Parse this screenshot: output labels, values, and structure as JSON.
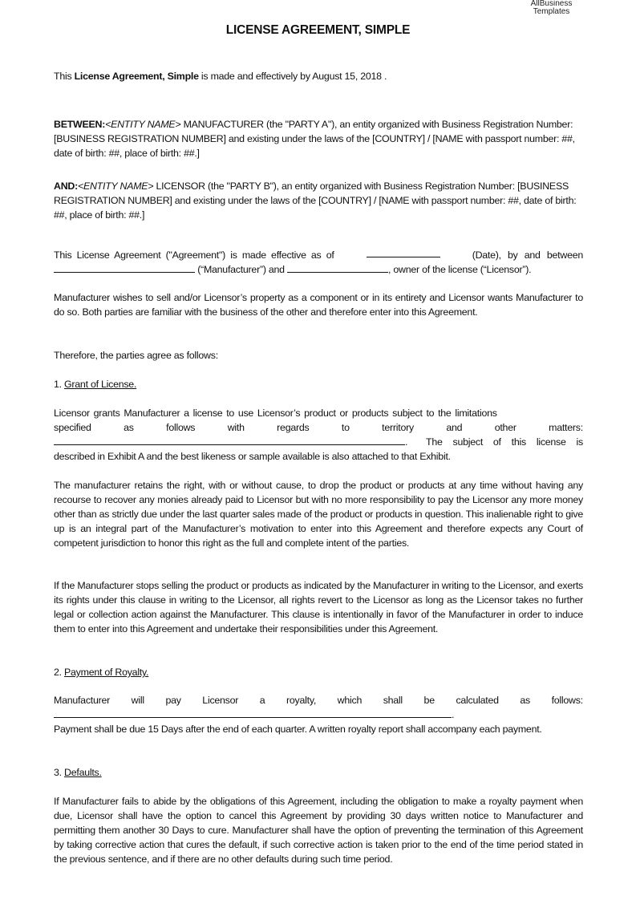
{
  "brand": {
    "line1": "AllBusiness",
    "line2": "Templates"
  },
  "title": "LICENSE AGREEMENT, SIMPLE",
  "intro": {
    "pre": "This ",
    "bold": "License Agreement, Simple",
    "post": " is made and effectively by August 15, 2018 ."
  },
  "party_a": {
    "label": "BETWEEN:",
    "entity": "<ENTITY NAME>",
    "text": " MANUFACTURER (the \"PARTY A\"), an entity organized with Business Registration Number: [BUSINESS REGISTRATION NUMBER] and existing under the laws of the [COUNTRY] / [NAME with passport number: ##, date of birth: ##, place of birth: ##.]"
  },
  "party_b": {
    "label": "AND:",
    "entity": "<ENTITY NAME>",
    "text": " LICENSOR (the \"PARTY B\"), an entity organized with Business Registration Number: [BUSINESS REGISTRATION NUMBER] and existing under the laws of the [COUNTRY] / [NAME with passport number: ##, date of birth: ##, place of birth: ##.]"
  },
  "effective": {
    "part1": "This License Agreement (\"Agreement\") is made effective as of",
    "date_value": "",
    "part2": "(Date), by and between",
    "manufacturer_value": "",
    "part3": " (“Manufacturer”) and ",
    "licensor_value": "",
    "part4": ", owner of the license (“Licensor”)."
  },
  "recital": "Manufacturer wishes to sell and/or Licensor’s property as a component or in its entirety and Licensor wants Manufacturer to do so.  Both parties are familiar with the business of the other and therefore enter into this Agreement.",
  "therefore": "Therefore, the parties agree as follows:",
  "sections": [
    {
      "number": "1. ",
      "heading": "Grant of License.",
      "para1_line1": "Licensor grants Manufacturer a license to use Licensor’s product or products subject to the limitations",
      "para1_line2_words": [
        "specified",
        "as",
        "follows",
        "with",
        "regards",
        "to",
        "territory",
        "and",
        "other",
        "matters:"
      ],
      "para1_blank_value": "",
      "para1_line3_tail": ".",
      "para1_line3_words": [
        "The",
        "subject",
        "of",
        "this",
        "license",
        "is"
      ],
      "para1_line4": "described in Exhibit A and the best likeness or sample available is also attached to that Exhibit.",
      "para2": "The manufacturer retains the right, with or without cause, to drop the product or products at any time without having any recourse to recover any monies already paid to Licensor but with no more responsibility to pay the Licensor any more money other than as strictly due under the last quarter sales made of the product or products in question.  This inalienable right to give up is an integral part of the Manufacturer’s motivation to enter into this Agreement and therefore expects any Court of competent jurisdiction to honor this right as the full and complete intent of the parties.",
      "para3": "If the Manufacturer stops selling the product or products as indicated by the Manufacturer in writing to the Licensor, and exerts its rights under this clause in writing to the Licensor, all rights revert to the Licensor as long as the Licensor takes no further legal or collection action against the Manufacturer.  This clause is intentionally in favor of the Manufacturer in order to induce them to enter into this Agreement and undertake their responsibilities under this Agreement."
    },
    {
      "number": "2. ",
      "heading": "Payment of Royalty.",
      "line1_words": [
        "Manufacturer",
        "will",
        "pay",
        "Licensor",
        "a",
        "royalty,",
        "which",
        "shall",
        "be",
        "calculated",
        "as",
        "follows:"
      ],
      "blank_value": "",
      "blank_tail": ".",
      "para2": "Payment shall be due 15 Days after the end of each quarter.  A written royalty report shall accompany each payment."
    },
    {
      "number": "3. ",
      "heading": "Defaults.",
      "para1": "If Manufacturer fails to abide by the obligations of this Agreement, including the obligation to make a royalty payment when due, Licensor shall have the option to cancel this Agreement by providing 30 days written notice to Manufacturer and permitting them another 30 Days to cure.  Manufacturer shall have the option of preventing the termination of this Agreement by taking corrective action that cures the default, if such corrective action is taken prior to the end of the time period stated in the previous sentence, and if there are no other defaults during such time period."
    }
  ]
}
